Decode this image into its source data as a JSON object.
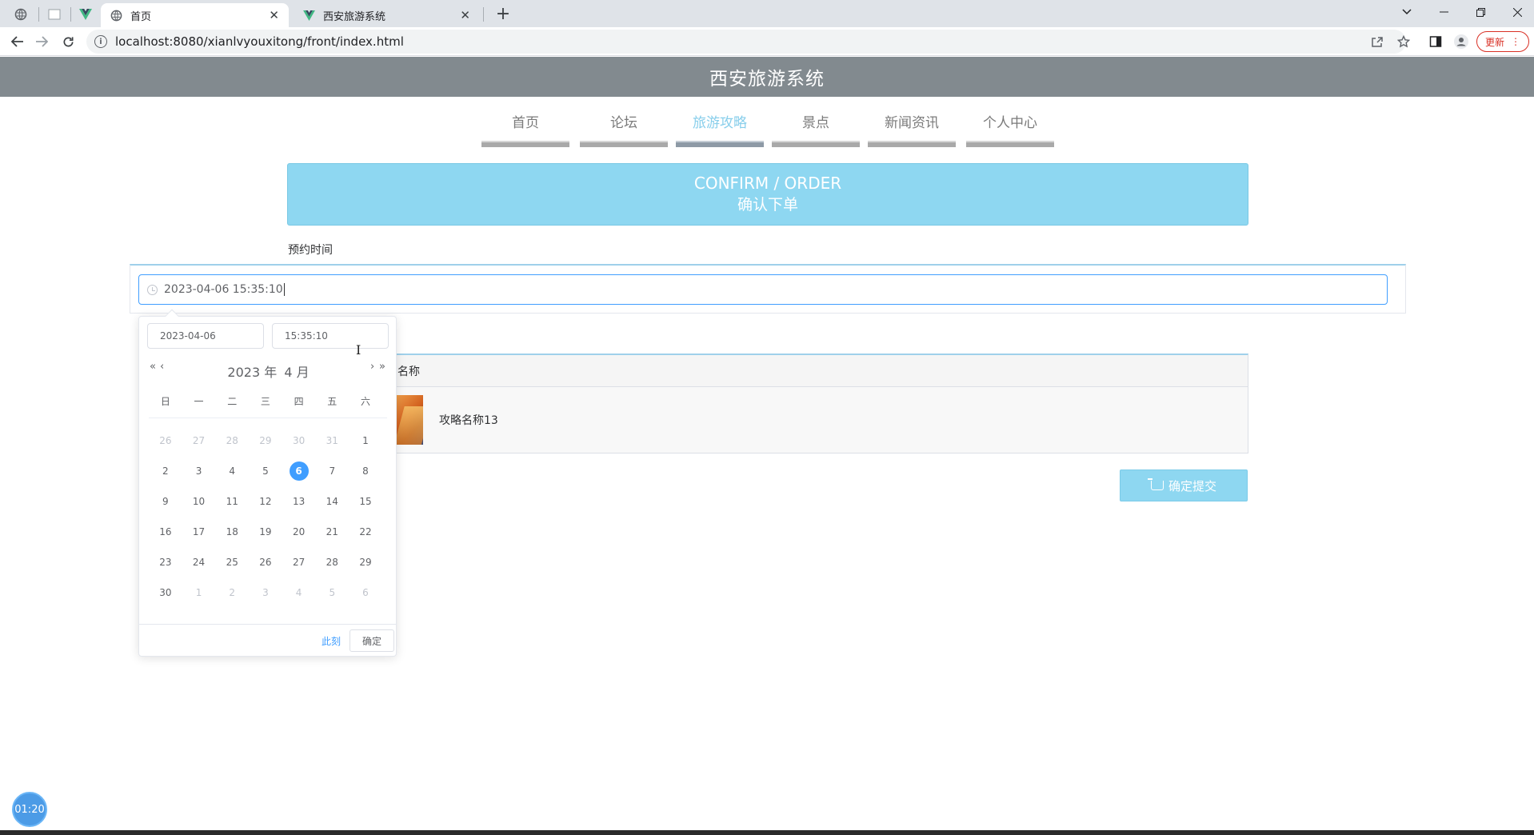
{
  "browser": {
    "tabs": [
      {
        "title": "首页",
        "active": true
      },
      {
        "title": "西安旅游系统",
        "active": false
      }
    ],
    "new_tab": "+",
    "url": "localhost:8080/xianlvyouxitong/front/index.html",
    "update_label": "更新"
  },
  "site": {
    "title": "西安旅游系统",
    "nav": [
      {
        "label": "首页",
        "active": false
      },
      {
        "label": "论坛",
        "active": false
      },
      {
        "label": "旅游攻略",
        "active": true
      },
      {
        "label": "景点",
        "active": false
      },
      {
        "label": "新闻资讯",
        "active": false
      },
      {
        "label": "个人中心",
        "active": false
      }
    ]
  },
  "banner": {
    "en": "CONFIRM / ORDER",
    "cn": "确认下单"
  },
  "form": {
    "reserve_label": "预约时间",
    "reserve_value": "2023-04-06 15:35:10"
  },
  "order": {
    "column_header": "名称",
    "item_name": "攻略名称13"
  },
  "submit_label": "确定提交",
  "picker": {
    "date_input": "2023-04-06",
    "time_input": "15:35:10",
    "prev_year": "«",
    "prev_month": "‹",
    "next_month": "›",
    "next_year": "»",
    "year": "2023 年",
    "month": "4 月",
    "weekdays": [
      "日",
      "一",
      "二",
      "三",
      "四",
      "五",
      "六"
    ],
    "weeks": [
      [
        {
          "d": "26",
          "m": true
        },
        {
          "d": "27",
          "m": true
        },
        {
          "d": "28",
          "m": true
        },
        {
          "d": "29",
          "m": true
        },
        {
          "d": "30",
          "m": true
        },
        {
          "d": "31",
          "m": true
        },
        {
          "d": "1",
          "m": false
        }
      ],
      [
        {
          "d": "2",
          "m": false
        },
        {
          "d": "3",
          "m": false
        },
        {
          "d": "4",
          "m": false
        },
        {
          "d": "5",
          "m": false
        },
        {
          "d": "6",
          "m": false,
          "s": true
        },
        {
          "d": "7",
          "m": false
        },
        {
          "d": "8",
          "m": false
        }
      ],
      [
        {
          "d": "9",
          "m": false
        },
        {
          "d": "10",
          "m": false
        },
        {
          "d": "11",
          "m": false
        },
        {
          "d": "12",
          "m": false
        },
        {
          "d": "13",
          "m": false
        },
        {
          "d": "14",
          "m": false
        },
        {
          "d": "15",
          "m": false
        }
      ],
      [
        {
          "d": "16",
          "m": false
        },
        {
          "d": "17",
          "m": false
        },
        {
          "d": "18",
          "m": false
        },
        {
          "d": "19",
          "m": false
        },
        {
          "d": "20",
          "m": false
        },
        {
          "d": "21",
          "m": false
        },
        {
          "d": "22",
          "m": false
        }
      ],
      [
        {
          "d": "23",
          "m": false
        },
        {
          "d": "24",
          "m": false
        },
        {
          "d": "25",
          "m": false
        },
        {
          "d": "26",
          "m": false
        },
        {
          "d": "27",
          "m": false
        },
        {
          "d": "28",
          "m": false
        },
        {
          "d": "29",
          "m": false
        }
      ],
      [
        {
          "d": "30",
          "m": false
        },
        {
          "d": "1",
          "m": true
        },
        {
          "d": "2",
          "m": true
        },
        {
          "d": "3",
          "m": true
        },
        {
          "d": "4",
          "m": true
        },
        {
          "d": "5",
          "m": true
        },
        {
          "d": "6",
          "m": true
        }
      ]
    ],
    "now_label": "此刻",
    "confirm_label": "确定"
  },
  "timer": "01:20",
  "colors": {
    "accent": "#409eff",
    "banner": "#8ed7f1",
    "header": "#828a8f",
    "nav_active": "#87ceeb"
  }
}
